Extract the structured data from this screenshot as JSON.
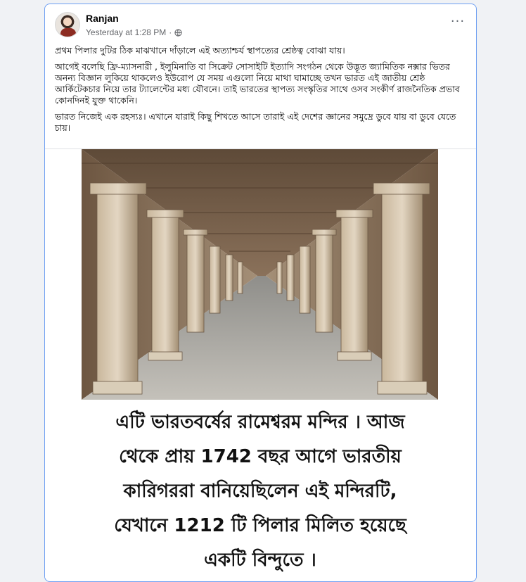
{
  "post": {
    "author": "Ranjan",
    "timestamp": "Yesterday at 1:28 PM",
    "separator": "·",
    "privacy_icon": "globe-icon",
    "more_icon": "···",
    "paragraphs": [
      "প্রথম পিলার দুটির ঠিক মাঝখানে দাঁড়ালে এই অত্যাশ্চর্য স্থাপত্যের শ্রেষ্ঠত্ব বোঝা যায়।",
      "আগেই বলেছি ফ্রি-ম্যাসনারী , ইলুমিনাতি বা সিক্রেট সোসাইটি ইত্যাদি সংগঠন থেকে উদ্ভূত জ্যামিতিক নক্সার ভিতর অনন্য বিজ্ঞান লুকিয়ে থাকলেও ইউরোপ যে সময় এগুলো নিয়ে মাথা ঘামাচ্ছে তখন ভারত এই জাতীয় শ্রেষ্ঠ আর্কিটেকচার  নিয়ে তার ট্যালেন্টের মধ্য যৌবনে। তাই ভারতের স্থাপত্য সংস্কৃতির সাথে ওসব সংকীর্ণ রাজনৈতিক প্রভাব কোনদিনই যুক্ত থাকেনি।",
      "ভারত নিজেই এক রহস্যঃ। এখানে যারাই কিছু শিখতে আসে তারাই এই দেশের জ্ঞানের সমুদ্রে ডুবে যায় বা ডুবে যেতে চায়।"
    ]
  },
  "image": {
    "caption_lines": [
      "এটি ভারতবর্ষের রামেশ্বরম মন্দির  । আজ",
      "থেকে প্রায় 1742 বছর আগে ভারতীয়",
      "কারিগররা বানিয়েছিলেন এই মন্দিরটি,",
      "যেখানে 1212 টি পিলার মিলিত হয়েছে",
      "একটি বিন্দুতে  ।"
    ]
  },
  "colors": {
    "page_bg": "#f0f2f5",
    "card_border": "#6e9ff2",
    "secondary_text": "#65676b"
  }
}
